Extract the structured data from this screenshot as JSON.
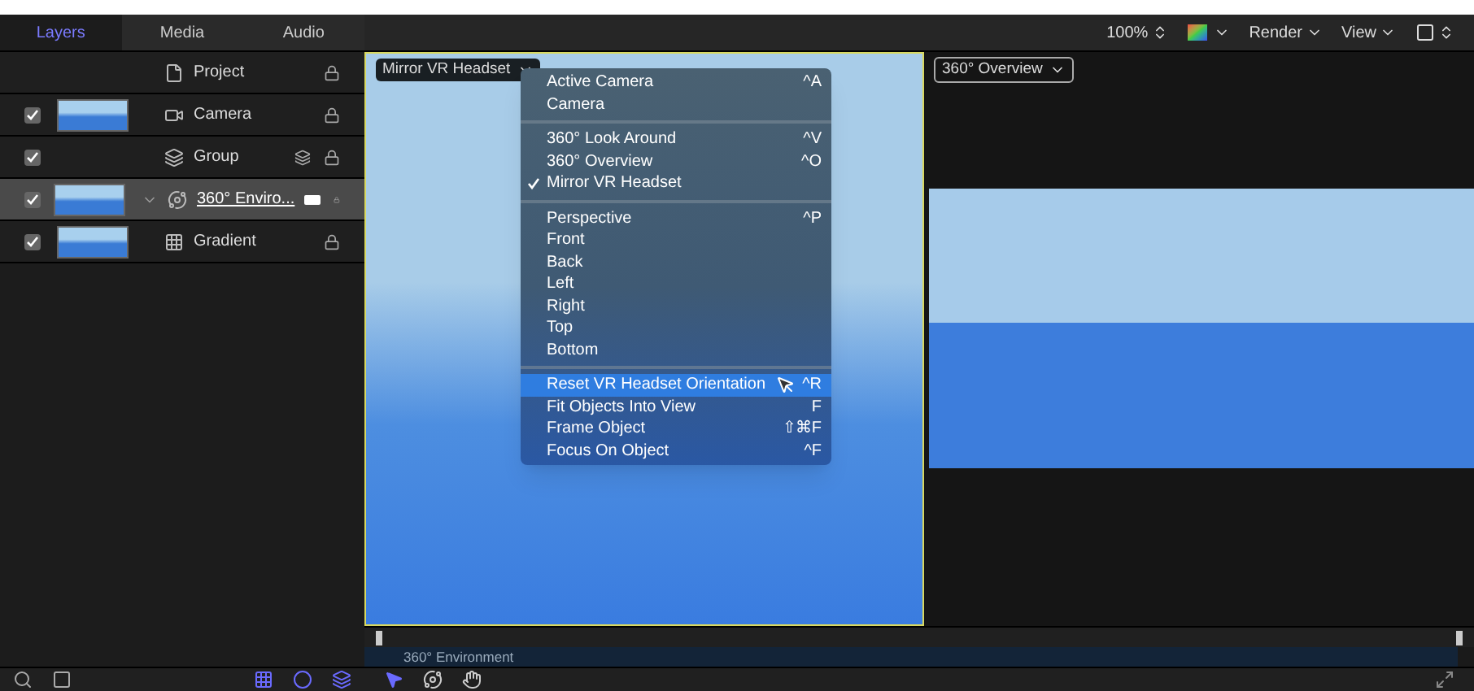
{
  "panel_tabs": [
    {
      "label": "Layers",
      "selected": true
    },
    {
      "label": "Media",
      "selected": false
    },
    {
      "label": "Audio",
      "selected": false
    }
  ],
  "layers": [
    {
      "name": "Project",
      "kind": "project",
      "selected": false
    },
    {
      "name": "Camera",
      "kind": "camera",
      "checked": true,
      "thumbnail": true,
      "selected": false
    },
    {
      "name": "Group",
      "kind": "group",
      "checked": true,
      "thumbnail": false,
      "selected": false
    },
    {
      "name": "360° Enviro...",
      "kind": "environment",
      "checked": true,
      "thumbnail": true,
      "selected": true
    },
    {
      "name": "Gradient",
      "kind": "gradient",
      "checked": true,
      "thumbnail": true,
      "selected": false
    }
  ],
  "toolbar": {
    "zoom": "100%",
    "render": "Render",
    "view": "View"
  },
  "viewer": {
    "camera_menu": "Mirror VR Headset",
    "overview_menu": "360° Overview"
  },
  "camera_popup": [
    [
      {
        "label": "Active Camera",
        "shortcut": "^A",
        "checked": false,
        "selected": false
      },
      {
        "label": "Camera",
        "checked": false,
        "selected": false
      }
    ],
    [
      {
        "label": "360° Look Around",
        "shortcut": "^V",
        "checked": false,
        "selected": false
      },
      {
        "label": "360° Overview",
        "shortcut": "^O",
        "checked": false,
        "selected": false
      },
      {
        "label": "Mirror VR Headset",
        "checked": true,
        "selected": false
      }
    ],
    [
      {
        "label": "Perspective",
        "shortcut": "^P",
        "checked": false,
        "selected": false
      },
      {
        "label": "Front",
        "checked": false,
        "selected": false
      },
      {
        "label": "Back",
        "checked": false,
        "selected": false
      },
      {
        "label": "Left",
        "checked": false,
        "selected": false
      },
      {
        "label": "Right",
        "checked": false,
        "selected": false
      },
      {
        "label": "Top",
        "checked": false,
        "selected": false
      },
      {
        "label": "Bottom",
        "checked": false,
        "selected": false
      }
    ],
    [
      {
        "label": "Reset VR Headset Orientation",
        "shortcut": "^R",
        "checked": false,
        "selected": true
      },
      {
        "label": "Fit Objects Into View",
        "shortcut": "F",
        "checked": false,
        "selected": false
      },
      {
        "label": "Frame Object",
        "shortcut": "⇧⌘F",
        "checked": false,
        "selected": false
      },
      {
        "label": "Focus On Object",
        "shortcut": "^F",
        "checked": false,
        "selected": false
      }
    ]
  ],
  "timeline": {
    "bar": "360° Environment"
  }
}
